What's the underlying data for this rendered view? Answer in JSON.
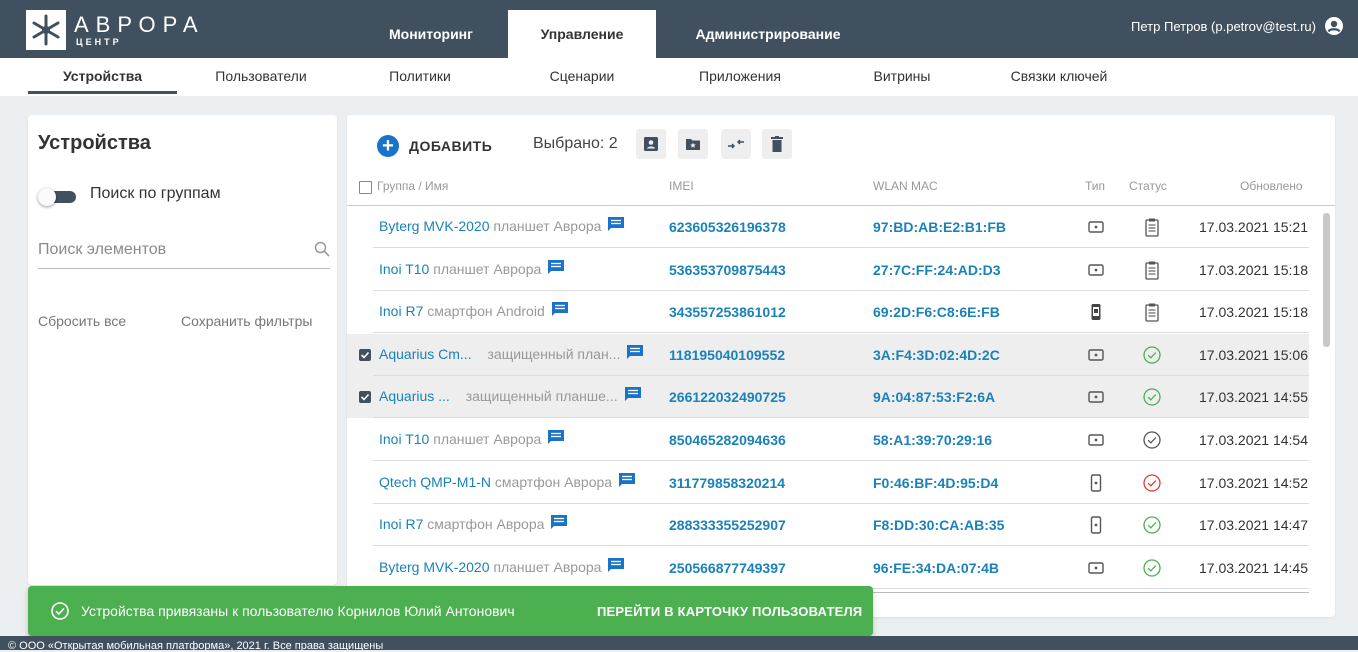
{
  "brand": {
    "name": "АВРОРА",
    "sub": "ЦЕНТР"
  },
  "main_tabs": [
    {
      "label": "Мониторинг",
      "active": false
    },
    {
      "label": "Управление",
      "active": true
    },
    {
      "label": "Администрирование",
      "active": false
    }
  ],
  "user": {
    "label": "Петр Петров (p.petrov@test.ru)",
    "icon": "account-circle-icon"
  },
  "sub_tabs": [
    {
      "label": "Устройства",
      "active": true
    },
    {
      "label": "Пользователи"
    },
    {
      "label": "Политики"
    },
    {
      "label": "Сценарии"
    },
    {
      "label": "Приложения"
    },
    {
      "label": "Витрины"
    },
    {
      "label": "Связки ключей"
    }
  ],
  "filters": {
    "title": "Устройства",
    "group_search_toggle": "Поиск по группам",
    "search_placeholder": "Поиск элементов",
    "reset_label": "Сбросить все",
    "save_label": "Сохранить фильтры"
  },
  "toolbar": {
    "add_label": "ДОБАВИТЬ",
    "selected_label": "Выбрано: 2",
    "actions": [
      "assign-user-icon",
      "folder-star-icon",
      "swap-icon",
      "delete-icon"
    ]
  },
  "table": {
    "headers": {
      "name": "Группа / Имя",
      "imei": "IMEI",
      "mac": "WLAN MAC",
      "type": "Тип",
      "status": "Статус",
      "updated": "Обновлено"
    },
    "rows": [
      {
        "name": "Byterg MVK-2020",
        "type": "планшет Аврора",
        "imei": "623605326196378",
        "mac": "97:BD:AB:E2:B1:FB",
        "device": "tablet",
        "status": "pending",
        "updated": "17.03.2021 15:21",
        "selected": false
      },
      {
        "name": "Inoi T10",
        "type": "планшет Аврора",
        "imei": "536353709875443",
        "mac": "27:7C:FF:24:AD:D3",
        "device": "tablet",
        "status": "pending",
        "updated": "17.03.2021 15:18",
        "selected": false
      },
      {
        "name": "Inoi R7",
        "type": "смартфон Android",
        "imei": "343557253861012",
        "mac": "69:2D:F6:C8:6E:FB",
        "device": "phone-android",
        "status": "pending",
        "updated": "17.03.2021 15:18",
        "selected": false
      },
      {
        "name": "Aquarius Cm...",
        "type": "защищенный план...",
        "imei": "118195040109552",
        "mac": "3A:F4:3D:02:4D:2C",
        "device": "tablet",
        "status": "ok",
        "updated": "17.03.2021 15:06",
        "selected": true
      },
      {
        "name": "Aquarius ...",
        "type": "защищенный планше...",
        "imei": "266122032490725",
        "mac": "9A:04:87:53:F2:6A",
        "device": "tablet",
        "status": "ok",
        "updated": "17.03.2021 14:55",
        "selected": true
      },
      {
        "name": "Inoi T10",
        "type": "планшет Аврора",
        "imei": "850465282094636",
        "mac": "58:A1:39:70:29:16",
        "device": "tablet",
        "status": "neutral",
        "updated": "17.03.2021 14:54",
        "selected": false
      },
      {
        "name": "Qtech QMP-M1-N",
        "type": "смартфон Аврора",
        "imei": "311779858320214",
        "mac": "F0:46:BF:4D:95:D4",
        "device": "phone",
        "status": "error",
        "updated": "17.03.2021 14:52",
        "selected": false
      },
      {
        "name": "Inoi R7",
        "type": "смартфон Аврора",
        "imei": "288333355252907",
        "mac": "F8:DD:30:CA:AB:35",
        "device": "phone",
        "status": "ok",
        "updated": "17.03.2021 14:47",
        "selected": false
      },
      {
        "name": "Byterg MVK-2020",
        "type": "планшет Аврора",
        "imei": "250566877749397",
        "mac": "96:FE:34:DA:07:4B",
        "device": "tablet",
        "status": "ok",
        "updated": "17.03.2021 14:45",
        "selected": false
      }
    ]
  },
  "toast": {
    "message": "Устройства привязаны к пользователю Корнилов Юлий Антонович",
    "action": "ПЕРЕЙТИ В КАРТОЧКУ ПОЛЬЗОВАТЕЛЯ"
  },
  "footer": {
    "text": "© ООО «Открытая мобильная платформа», 2021 г. Все права защищены"
  },
  "colors": {
    "header_bg": "#41505f",
    "link": "#1a82b9",
    "accent": "#1a73c9",
    "success": "#4caf50",
    "error": "#e53935",
    "ok": "#4caf50"
  }
}
